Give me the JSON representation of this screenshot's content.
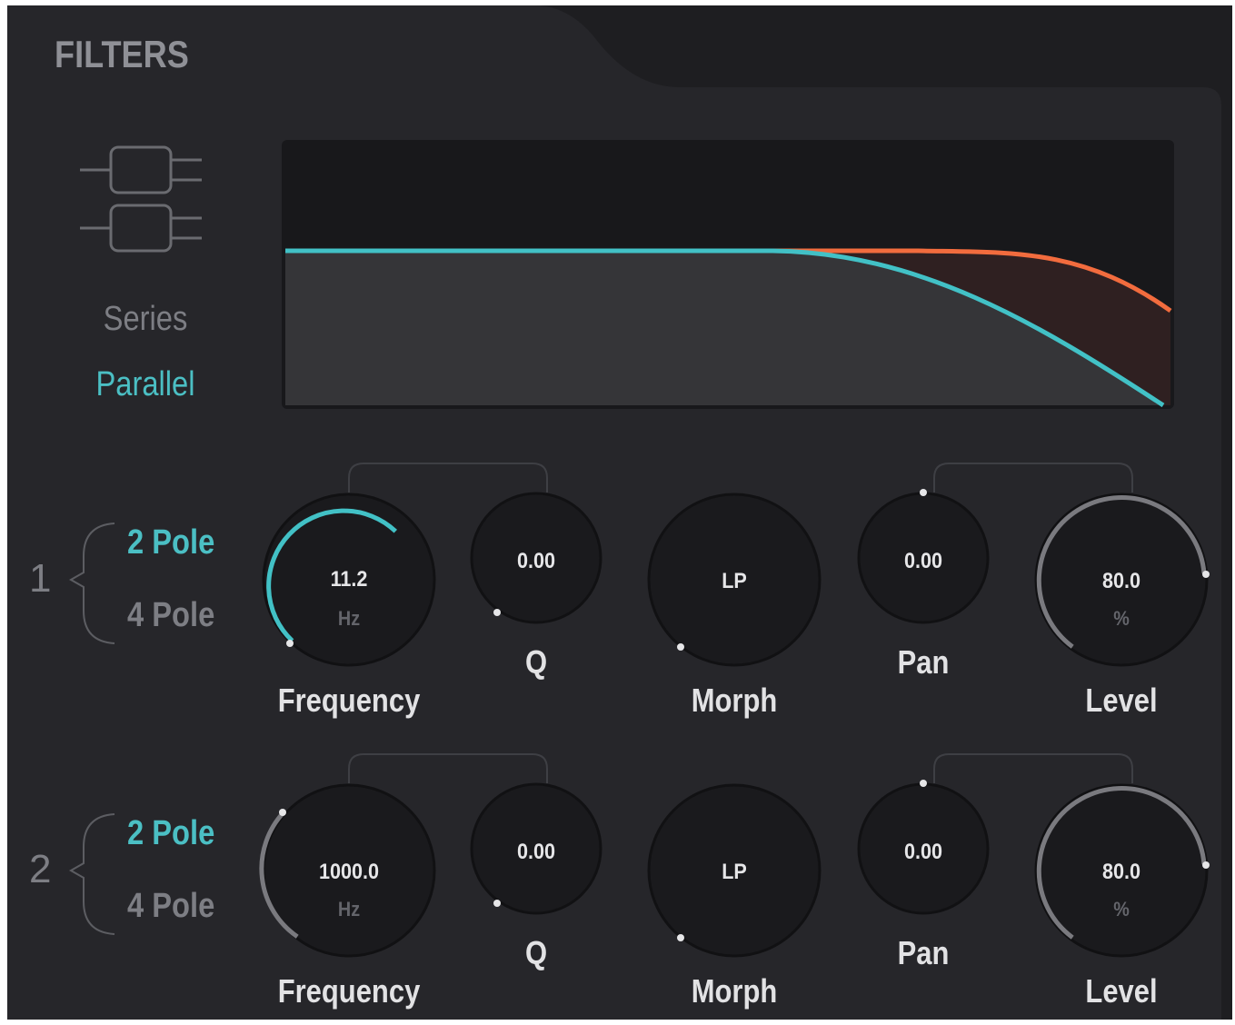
{
  "section": {
    "title": "FILTERS"
  },
  "routing": {
    "icon": "parallel-filters-icon",
    "modes": [
      "Series",
      "Parallel"
    ],
    "selected": "Parallel"
  },
  "display": {
    "curve_colors": {
      "filter1": "#42c1c6",
      "filter2": "#f26c3e"
    }
  },
  "filters": [
    {
      "number": "1",
      "poles": {
        "option_a": "2 Pole",
        "option_b": "4 Pole",
        "selected": "2 Pole"
      },
      "frequency": {
        "label": "Frequency",
        "value": "11.2",
        "unit": "Hz"
      },
      "q": {
        "label": "Q",
        "value": "0.00"
      },
      "morph": {
        "label": "Morph",
        "value": "LP"
      },
      "pan": {
        "label": "Pan",
        "value": "0.00"
      },
      "level": {
        "label": "Level",
        "value": "80.0",
        "unit": "%"
      }
    },
    {
      "number": "2",
      "poles": {
        "option_a": "2 Pole",
        "option_b": "4 Pole",
        "selected": "2 Pole"
      },
      "frequency": {
        "label": "Frequency",
        "value": "1000.0",
        "unit": "Hz"
      },
      "q": {
        "label": "Q",
        "value": "0.00"
      },
      "morph": {
        "label": "Morph",
        "value": "LP"
      },
      "pan": {
        "label": "Pan",
        "value": "0.00"
      },
      "level": {
        "label": "Level",
        "value": "80.0",
        "unit": "%"
      }
    }
  ],
  "colors": {
    "accent": "#4bbfc4",
    "secondary_curve": "#f26c3e",
    "arc_gray": "#7a7a7f"
  }
}
